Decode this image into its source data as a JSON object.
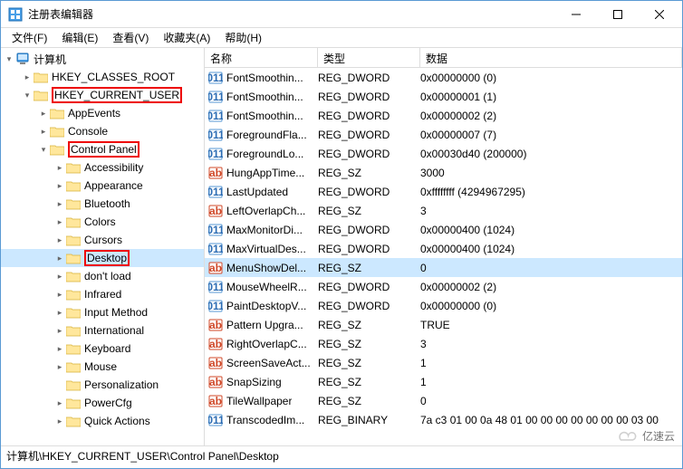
{
  "window": {
    "title": "注册表编辑器"
  },
  "menus": [
    {
      "label": "文件(F)"
    },
    {
      "label": "编辑(E)"
    },
    {
      "label": "查看(V)"
    },
    {
      "label": "收藏夹(A)"
    },
    {
      "label": "帮助(H)"
    }
  ],
  "tree": {
    "root": "计算机",
    "items": [
      {
        "indent": 1,
        "exp": ">",
        "label": "HKEY_CLASSES_ROOT"
      },
      {
        "indent": 1,
        "exp": "v",
        "label": "HKEY_CURRENT_USER",
        "hl": true
      },
      {
        "indent": 2,
        "exp": ">",
        "label": "AppEvents"
      },
      {
        "indent": 2,
        "exp": ">",
        "label": "Console"
      },
      {
        "indent": 2,
        "exp": "v",
        "label": "Control Panel",
        "hl": true
      },
      {
        "indent": 3,
        "exp": ">",
        "label": "Accessibility"
      },
      {
        "indent": 3,
        "exp": ">",
        "label": "Appearance"
      },
      {
        "indent": 3,
        "exp": ">",
        "label": "Bluetooth"
      },
      {
        "indent": 3,
        "exp": ">",
        "label": "Colors"
      },
      {
        "indent": 3,
        "exp": ">",
        "label": "Cursors"
      },
      {
        "indent": 3,
        "exp": ">",
        "label": "Desktop",
        "hl": true,
        "sel": true
      },
      {
        "indent": 3,
        "exp": ">",
        "label": "don't load"
      },
      {
        "indent": 3,
        "exp": ">",
        "label": "Infrared"
      },
      {
        "indent": 3,
        "exp": ">",
        "label": "Input Method"
      },
      {
        "indent": 3,
        "exp": ">",
        "label": "International"
      },
      {
        "indent": 3,
        "exp": ">",
        "label": "Keyboard"
      },
      {
        "indent": 3,
        "exp": ">",
        "label": "Mouse"
      },
      {
        "indent": 3,
        "exp": "",
        "label": "Personalization"
      },
      {
        "indent": 3,
        "exp": ">",
        "label": "PowerCfg"
      },
      {
        "indent": 3,
        "exp": ">",
        "label": "Quick Actions"
      }
    ]
  },
  "columns": {
    "name": "名称",
    "type": "类型",
    "data": "数据"
  },
  "values": [
    {
      "icon": "bin",
      "name": "FontSmoothin...",
      "type": "REG_DWORD",
      "data": "0x00000000 (0)"
    },
    {
      "icon": "bin",
      "name": "FontSmoothin...",
      "type": "REG_DWORD",
      "data": "0x00000001 (1)"
    },
    {
      "icon": "bin",
      "name": "FontSmoothin...",
      "type": "REG_DWORD",
      "data": "0x00000002 (2)"
    },
    {
      "icon": "bin",
      "name": "ForegroundFla...",
      "type": "REG_DWORD",
      "data": "0x00000007 (7)"
    },
    {
      "icon": "bin",
      "name": "ForegroundLo...",
      "type": "REG_DWORD",
      "data": "0x00030d40 (200000)"
    },
    {
      "icon": "str",
      "name": "HungAppTime...",
      "type": "REG_SZ",
      "data": "3000"
    },
    {
      "icon": "bin",
      "name": "LastUpdated",
      "type": "REG_DWORD",
      "data": "0xffffffff (4294967295)"
    },
    {
      "icon": "str",
      "name": "LeftOverlapCh...",
      "type": "REG_SZ",
      "data": "3"
    },
    {
      "icon": "bin",
      "name": "MaxMonitorDi...",
      "type": "REG_DWORD",
      "data": "0x00000400 (1024)"
    },
    {
      "icon": "bin",
      "name": "MaxVirtualDes...",
      "type": "REG_DWORD",
      "data": "0x00000400 (1024)"
    },
    {
      "icon": "str",
      "name": "MenuShowDel...",
      "type": "REG_SZ",
      "data": "0",
      "sel": true
    },
    {
      "icon": "bin",
      "name": "MouseWheelR...",
      "type": "REG_DWORD",
      "data": "0x00000002 (2)"
    },
    {
      "icon": "bin",
      "name": "PaintDesktopV...",
      "type": "REG_DWORD",
      "data": "0x00000000 (0)"
    },
    {
      "icon": "str",
      "name": "Pattern Upgra...",
      "type": "REG_SZ",
      "data": "TRUE"
    },
    {
      "icon": "str",
      "name": "RightOverlapC...",
      "type": "REG_SZ",
      "data": "3"
    },
    {
      "icon": "str",
      "name": "ScreenSaveAct...",
      "type": "REG_SZ",
      "data": "1"
    },
    {
      "icon": "str",
      "name": "SnapSizing",
      "type": "REG_SZ",
      "data": "1"
    },
    {
      "icon": "str",
      "name": "TileWallpaper",
      "type": "REG_SZ",
      "data": "0"
    },
    {
      "icon": "bin",
      "name": "TranscodedIm...",
      "type": "REG_BINARY",
      "data": "7a c3 01 00 0a 48 01 00 00 00 00 00 00 00 03 00"
    }
  ],
  "status": {
    "path": "计算机\\HKEY_CURRENT_USER\\Control Panel\\Desktop"
  },
  "watermark": "亿速云"
}
